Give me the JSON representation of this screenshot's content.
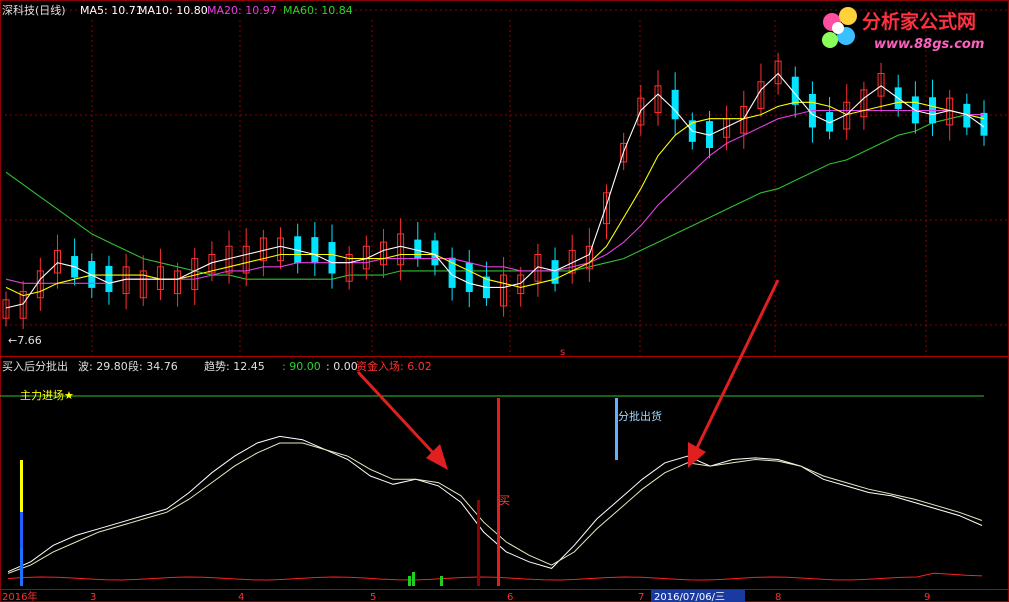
{
  "header": {
    "stock": "深科技(日线)",
    "ma5": "MA5: 10.71",
    "ma10": "MA10: 10.80",
    "ma20": "MA20: 10.97",
    "ma60": "MA60: 10.84"
  },
  "logo": {
    "main": "分析家公式网",
    "url": "www.88gs.com"
  },
  "indicator": {
    "name": "买入后分批出",
    "wave": "波: 29.80",
    "seg": "段: 34.76",
    "trend": "趋势: 12.45",
    "v1": ": 90.00",
    "v2": ": 0.00",
    "fund": "资金入场: 6.02",
    "main_force": "主力进场★",
    "buy": "买",
    "sell": "分批出货"
  },
  "annotations": {
    "low_price": "←7.66",
    "marker": "s"
  },
  "xaxis": {
    "ticks": [
      "2016年",
      "3",
      "4",
      "5",
      "6",
      "7",
      "2016/07/06/三",
      "8",
      "9"
    ]
  },
  "colors": {
    "up": "#ff3030",
    "down": "#00e5ff",
    "ma5": "#ffffff",
    "ma10": "#ffff00",
    "ma20": "#e040e0",
    "ma60": "#30c030",
    "grid": "#8b0000",
    "arrow": "#e02020"
  },
  "chart_data": [
    {
      "type": "candlestick",
      "series": [
        {
          "name": "MA5",
          "values": [
            8.2,
            8.3,
            8.9,
            9.3,
            9.2,
            9.0,
            8.8,
            8.9,
            8.9,
            8.9,
            8.9,
            9.1,
            9.3,
            9.4,
            9.5,
            9.6,
            9.7,
            9.6,
            9.5,
            9.3,
            9.3,
            9.4,
            9.6,
            9.7,
            9.6,
            9.5,
            9.0,
            8.8,
            8.7,
            8.7,
            8.8,
            9.2,
            9.1,
            9.3,
            9.5,
            10.7,
            12.0,
            13.0,
            13.4,
            13.0,
            12.5,
            12.4,
            12.6,
            12.8,
            13.5,
            13.9,
            13.4,
            12.9,
            12.7,
            12.9,
            13.3,
            13.6,
            13.3,
            13.0,
            12.9,
            13.0,
            12.9,
            12.6
          ]
        },
        {
          "name": "MA10",
          "values": [
            8.7,
            8.5,
            8.6,
            8.8,
            8.9,
            9.0,
            9.0,
            9.0,
            9.0,
            8.9,
            8.9,
            9.0,
            9.1,
            9.2,
            9.3,
            9.4,
            9.5,
            9.5,
            9.5,
            9.5,
            9.4,
            9.4,
            9.4,
            9.5,
            9.5,
            9.5,
            9.3,
            9.1,
            8.9,
            8.8,
            8.7,
            8.8,
            8.9,
            9.1,
            9.3,
            9.7,
            10.4,
            11.1,
            11.9,
            12.4,
            12.7,
            12.8,
            12.8,
            12.8,
            12.9,
            13.1,
            13.2,
            13.2,
            13.1,
            12.9,
            13.0,
            13.1,
            13.2,
            13.2,
            13.1,
            13.0,
            12.9,
            12.8
          ]
        },
        {
          "name": "MA20",
          "values": [
            8.9,
            8.8,
            8.8,
            8.8,
            8.8,
            8.8,
            8.8,
            8.9,
            8.9,
            8.9,
            8.9,
            8.9,
            9.0,
            9.1,
            9.1,
            9.2,
            9.2,
            9.3,
            9.3,
            9.3,
            9.3,
            9.3,
            9.4,
            9.4,
            9.4,
            9.4,
            9.4,
            9.3,
            9.2,
            9.2,
            9.1,
            9.1,
            9.1,
            9.2,
            9.3,
            9.5,
            9.8,
            10.2,
            10.7,
            11.1,
            11.5,
            11.9,
            12.2,
            12.4,
            12.6,
            12.8,
            12.9,
            13.0,
            13.0,
            13.0,
            13.0,
            13.0,
            13.0,
            13.0,
            13.0,
            13.0,
            12.9,
            12.9
          ]
        },
        {
          "name": "MA60",
          "values": [
            11.5,
            11.2,
            10.9,
            10.6,
            10.3,
            10.0,
            9.8,
            9.6,
            9.4,
            9.3,
            9.2,
            9.1,
            9.0,
            9.0,
            8.9,
            8.9,
            8.9,
            8.9,
            8.9,
            8.9,
            9.0,
            9.0,
            9.0,
            9.1,
            9.1,
            9.1,
            9.1,
            9.1,
            9.1,
            9.1,
            9.1,
            9.1,
            9.1,
            9.1,
            9.2,
            9.3,
            9.4,
            9.6,
            9.8,
            10.0,
            10.2,
            10.4,
            10.6,
            10.8,
            11.0,
            11.1,
            11.3,
            11.5,
            11.7,
            11.8,
            12.0,
            12.2,
            12.4,
            12.5,
            12.7,
            12.8,
            12.9,
            12.8
          ]
        }
      ],
      "ylim": [
        7.3,
        15.2
      ]
    },
    {
      "type": "line",
      "series": [
        {
          "name": "K",
          "values": [
            2,
            8,
            18,
            24,
            28,
            32,
            36,
            40,
            50,
            62,
            72,
            80,
            84,
            82,
            76,
            70,
            60,
            55,
            58,
            54,
            44,
            26,
            14,
            8,
            4,
            18,
            34,
            46,
            58,
            68,
            72,
            66,
            70,
            71,
            70,
            66,
            58,
            54,
            50,
            48,
            44,
            40,
            36,
            30
          ]
        },
        {
          "name": "D",
          "values": [
            1,
            6,
            14,
            20,
            26,
            30,
            34,
            38,
            46,
            56,
            66,
            74,
            80,
            80,
            76,
            72,
            64,
            58,
            58,
            56,
            48,
            32,
            20,
            12,
            6,
            14,
            28,
            40,
            52,
            62,
            68,
            66,
            68,
            70,
            69,
            66,
            60,
            56,
            52,
            49,
            46,
            42,
            38,
            33
          ]
        }
      ],
      "ylim": [
        0,
        100
      ]
    }
  ]
}
